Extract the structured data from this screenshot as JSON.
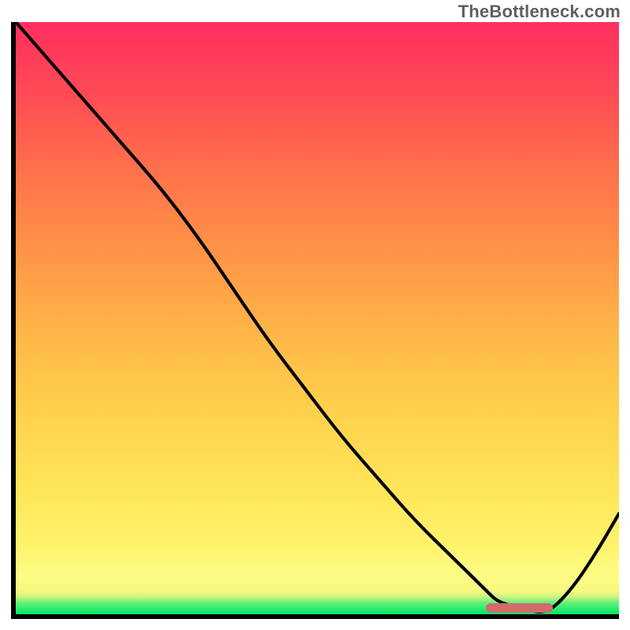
{
  "attribution": "TheBottleneck.com",
  "chart_data": {
    "type": "line",
    "title": "",
    "xlabel": "",
    "ylabel": "",
    "xlim": [
      0,
      100
    ],
    "ylim": [
      0,
      100
    ],
    "grid": false,
    "legend": false,
    "series": [
      {
        "name": "bottleneck-curve",
        "x": [
          0,
          6,
          12,
          18,
          24,
          30,
          36,
          42,
          48,
          54,
          60,
          66,
          72,
          78,
          80,
          84,
          88,
          92,
          96,
          100
        ],
        "values": [
          100,
          93,
          86,
          79,
          72,
          64,
          55,
          46,
          38,
          30,
          23,
          16,
          10,
          4,
          2,
          1,
          0,
          4,
          10,
          17
        ]
      }
    ],
    "background_gradient": {
      "orientation": "vertical",
      "stops": [
        {
          "pos": 0.0,
          "color": "#00e663"
        },
        {
          "pos": 0.02,
          "color": "#68f07a"
        },
        {
          "pos": 0.03,
          "color": "#d2f47f"
        },
        {
          "pos": 0.04,
          "color": "#f8f97e"
        },
        {
          "pos": 0.065,
          "color": "#fdfd86"
        },
        {
          "pos": 0.12,
          "color": "#fff26a"
        },
        {
          "pos": 0.22,
          "color": "#ffe457"
        },
        {
          "pos": 0.35,
          "color": "#ffcf4c"
        },
        {
          "pos": 0.48,
          "color": "#ffb547"
        },
        {
          "pos": 0.62,
          "color": "#ff9247"
        },
        {
          "pos": 0.76,
          "color": "#ff6e4b"
        },
        {
          "pos": 0.88,
          "color": "#ff4a55"
        },
        {
          "pos": 1.0,
          "color": "#ff2f60"
        }
      ]
    },
    "marker": {
      "name": "optimal-range",
      "x_start": 78,
      "x_end": 89,
      "y": 1,
      "color": "#d36a6c"
    }
  }
}
